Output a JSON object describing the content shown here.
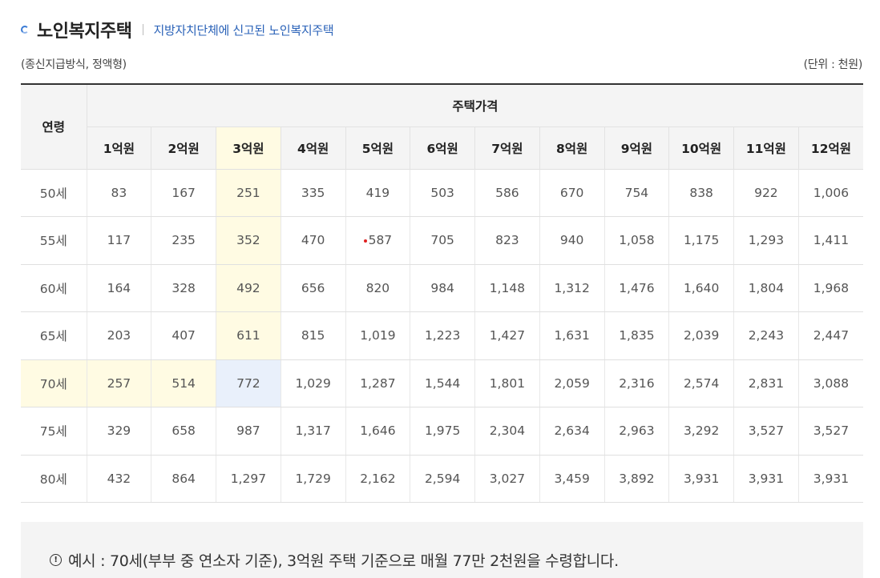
{
  "header": {
    "title": "노인복지주택",
    "subtitle": "지방자치단체에 신고된 노인복지주택",
    "note_left": "(종신지급방식, 정액형)",
    "note_right": "(단위 : 천원)"
  },
  "table": {
    "age_header": "연령",
    "price_header": "주택가격",
    "price_columns": [
      "1억원",
      "2억원",
      "3억원",
      "4억원",
      "5억원",
      "6억원",
      "7억원",
      "8억원",
      "9억원",
      "10억원",
      "11억원",
      "12억원"
    ],
    "rows": [
      {
        "age": "50세",
        "values": [
          "83",
          "167",
          "251",
          "335",
          "419",
          "503",
          "586",
          "670",
          "754",
          "838",
          "922",
          "1,006"
        ]
      },
      {
        "age": "55세",
        "values": [
          "117",
          "235",
          "352",
          "470",
          "587",
          "705",
          "823",
          "940",
          "1,058",
          "1,175",
          "1,293",
          "1,411"
        ]
      },
      {
        "age": "60세",
        "values": [
          "164",
          "328",
          "492",
          "656",
          "820",
          "984",
          "1,148",
          "1,312",
          "1,476",
          "1,640",
          "1,804",
          "1,968"
        ]
      },
      {
        "age": "65세",
        "values": [
          "203",
          "407",
          "611",
          "815",
          "1,019",
          "1,223",
          "1,427",
          "1,631",
          "1,835",
          "2,039",
          "2,243",
          "2,447"
        ]
      },
      {
        "age": "70세",
        "values": [
          "257",
          "514",
          "772",
          "1,029",
          "1,287",
          "1,544",
          "1,801",
          "2,059",
          "2,316",
          "2,574",
          "2,831",
          "3,088"
        ]
      },
      {
        "age": "75세",
        "values": [
          "329",
          "658",
          "987",
          "1,317",
          "1,646",
          "1,975",
          "2,304",
          "2,634",
          "2,963",
          "3,292",
          "3,527",
          "3,527"
        ]
      },
      {
        "age": "80세",
        "values": [
          "432",
          "864",
          "1,297",
          "1,729",
          "2,162",
          "2,594",
          "3,027",
          "3,459",
          "3,892",
          "3,931",
          "3,931",
          "3,931"
        ]
      }
    ]
  },
  "example": {
    "icon": "info-icon",
    "text": "예시 : 70세(부부 중 연소자 기준), 3억원 주택 기준으로 매월 77만 2천원을 수령합니다."
  },
  "colors": {
    "highlight_yellow": "#fffbe3",
    "highlight_blue": "#e9f0fb",
    "subtitle_blue": "#2a62b8"
  }
}
